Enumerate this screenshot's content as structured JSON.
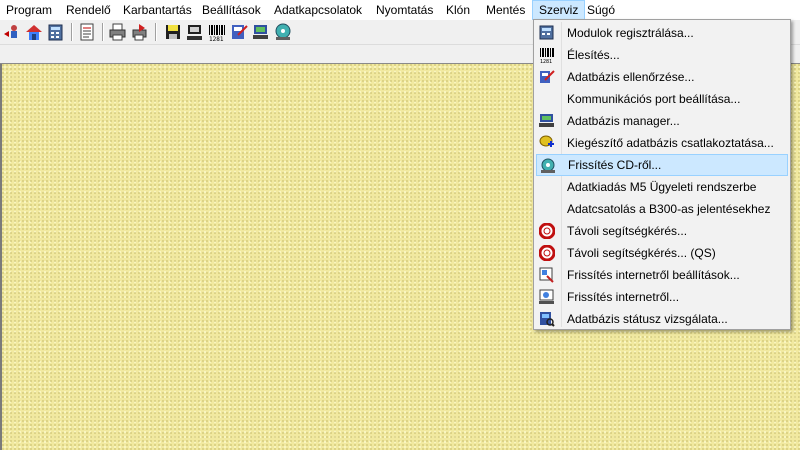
{
  "menubar": {
    "items": [
      {
        "label": "Program"
      },
      {
        "label": "Rendelő"
      },
      {
        "label": "Karbantartás"
      },
      {
        "label": "Beállítások"
      },
      {
        "label": "Adatkapcsolatok"
      },
      {
        "label": "Nyomtatás"
      },
      {
        "label": "Klón"
      },
      {
        "label": "Mentés"
      },
      {
        "label": "Szerviz"
      },
      {
        "label": "Súgó"
      }
    ],
    "active": "Szerviz"
  },
  "toolbar": {
    "buttons": [
      {
        "icon": "user-arrow-icon"
      },
      {
        "icon": "home-icon"
      },
      {
        "icon": "calculator-icon"
      },
      {
        "icon": "document-icon"
      },
      {
        "icon": "printer-icon"
      },
      {
        "icon": "print-export-icon"
      },
      {
        "icon": "save-icon"
      },
      {
        "icon": "computer-icon"
      },
      {
        "icon": "barcode-icon"
      },
      {
        "icon": "database-check-icon"
      },
      {
        "icon": "database-manager-icon"
      },
      {
        "icon": "cd-update-icon"
      }
    ]
  },
  "szerviz_menu": {
    "items": [
      {
        "label": "Modulok regisztrálása...",
        "icon": "module-register-icon"
      },
      {
        "label": "Élesítés...",
        "icon": "barcode-icon"
      },
      {
        "label": "Adatbázis ellenőrzése...",
        "icon": "database-check-icon"
      },
      {
        "label": "Kommunikációs port beállítása...",
        "icon": ""
      },
      {
        "label": "Adatbázis manager...",
        "icon": "database-manager-icon"
      },
      {
        "label": "Kiegészítő adatbázis csatlakoztatása...",
        "icon": "database-add-icon"
      },
      {
        "label": "Frissítés CD-ről...",
        "icon": "cd-update-icon"
      },
      {
        "label": "Adatkiadás M5 Ügyeleti rendszerbe",
        "icon": ""
      },
      {
        "label": "Adatcsatolás a B300-as jelentésekhez",
        "icon": ""
      },
      {
        "label": "Távoli segítségkérés...",
        "icon": "lifebuoy-icon"
      },
      {
        "label": "Távoli segítségkérés... (QS)",
        "icon": "lifebuoy-icon"
      },
      {
        "label": "Frissítés internetről beállítások...",
        "icon": "web-settings-icon"
      },
      {
        "label": "Frissítés internetről...",
        "icon": "web-update-icon"
      },
      {
        "label": "Adatbázis státusz vizsgálata...",
        "icon": "database-status-icon"
      }
    ],
    "highlighted": "Frissítés CD-ről..."
  }
}
